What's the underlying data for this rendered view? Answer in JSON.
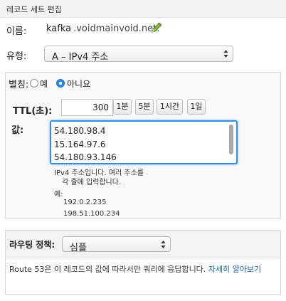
{
  "header": {
    "title": "레코드 세트 편집"
  },
  "name": {
    "label": "이름:",
    "value": "kafka",
    "domain": ".voidmainvoid.net."
  },
  "type": {
    "label": "유형:",
    "selected": "A – IPv4 주소"
  },
  "alias": {
    "label": "별칭:",
    "yes": "예",
    "no": "아니요",
    "selected": "no"
  },
  "ttl": {
    "label": "TTL(초):",
    "value": "300",
    "presets": [
      "1분",
      "5분",
      "1시간",
      "1일"
    ]
  },
  "value": {
    "label": "값:",
    "lines": [
      "54.180.98.4",
      "15.164.97.6",
      "54.180.93.146"
    ]
  },
  "help": {
    "line1": "IPv4 주소입니다. 여러 주소를",
    "line2": "각 줄에 입력합니다.",
    "example_label": "예:",
    "example1": "192.0.2.235",
    "example2": "198.51.100.234"
  },
  "routing": {
    "label": "라우팅 정책:",
    "selected": "심플",
    "description": "Route 53은 이 레코드의 값에 따라서만 쿼리에 응답합니다.",
    "link": "자세히 알아보기"
  },
  "colors": {
    "accent": "#2a8cf0",
    "link": "#1a64b3",
    "pencil": "#6fae2f"
  },
  "icons": {
    "edit": "pencil-icon",
    "select": "updown-arrows-icon"
  }
}
